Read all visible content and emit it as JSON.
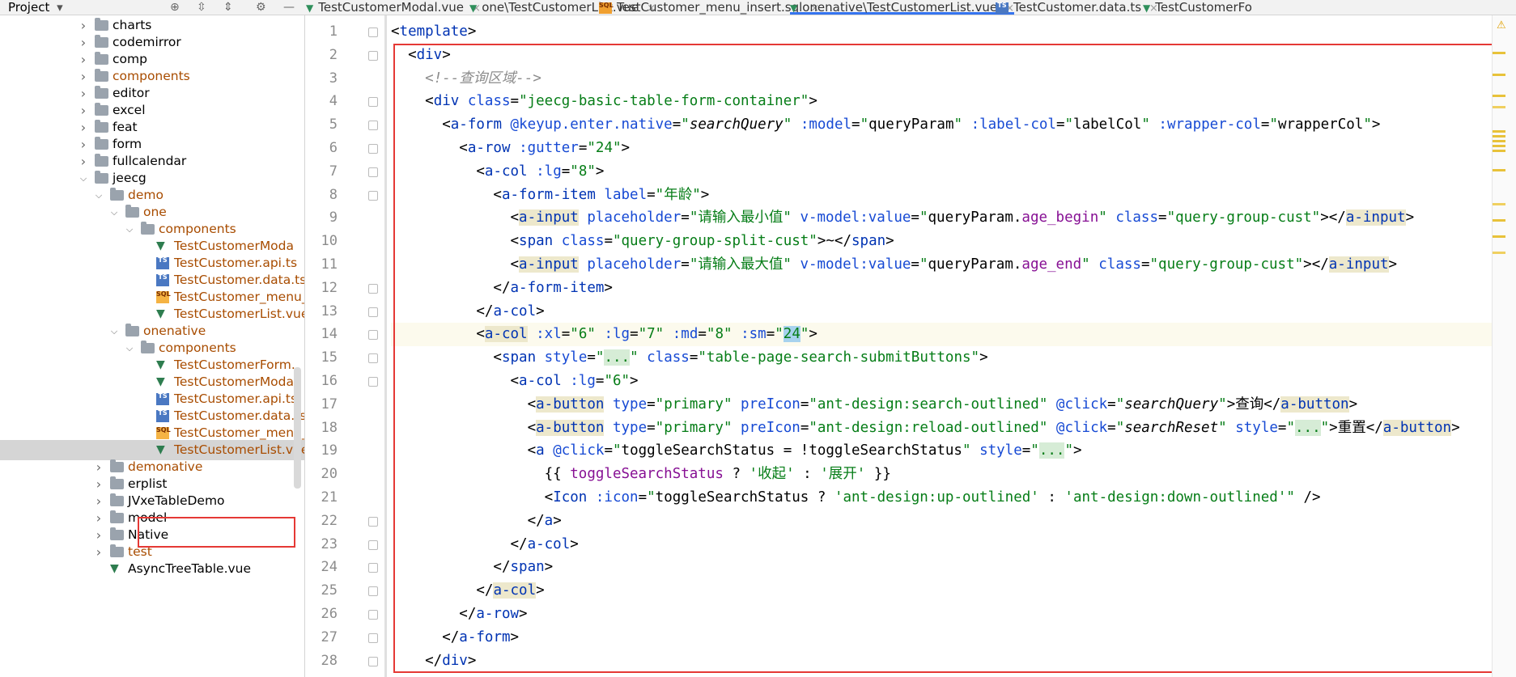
{
  "project_header": {
    "title": "Project",
    "dropdown_icon": "caret-down-icon"
  },
  "toolbar_icons": [
    "target-icon",
    "expand-all-icon",
    "collapse-all-icon",
    "gear-icon",
    "minimize-icon"
  ],
  "tabs": [
    {
      "label": "TestCustomerModal.vue",
      "icon": "vue-icon",
      "active": false
    },
    {
      "label": "one\\TestCustomerList.vue",
      "icon": "vue-icon",
      "active": false
    },
    {
      "label": "TestCustomer_menu_insert.sql",
      "icon": "sql-icon",
      "active": false
    },
    {
      "label": "onenative\\TestCustomerList.vue",
      "icon": "vue-icon",
      "active": true
    },
    {
      "label": "TestCustomer.data.ts",
      "icon": "ts-icon",
      "active": false
    },
    {
      "label": "TestCustomerFo",
      "icon": "vue-icon",
      "active": false
    }
  ],
  "icon_text": {
    "ts": "TS",
    "sql": "SQL",
    "vue": "▼",
    "close": "×",
    "caret": "▾",
    "warn": "⚠"
  },
  "tree": [
    {
      "label": "charts",
      "kind": "folder",
      "expanded": false,
      "color": "#000000"
    },
    {
      "label": "codemirror",
      "kind": "folder",
      "expanded": false,
      "color": "#000000"
    },
    {
      "label": "comp",
      "kind": "folder",
      "expanded": false,
      "color": "#000000"
    },
    {
      "label": "components",
      "kind": "folder",
      "expanded": false,
      "color": "#a84c00"
    },
    {
      "label": "editor",
      "kind": "folder",
      "expanded": false,
      "color": "#000000"
    },
    {
      "label": "excel",
      "kind": "folder",
      "expanded": false,
      "color": "#000000"
    },
    {
      "label": "feat",
      "kind": "folder",
      "expanded": false,
      "color": "#000000"
    },
    {
      "label": "form",
      "kind": "folder",
      "expanded": false,
      "color": "#000000"
    },
    {
      "label": "fullcalendar",
      "kind": "folder",
      "expanded": false,
      "color": "#000000"
    },
    {
      "label": "jeecg",
      "kind": "folder",
      "expanded": true,
      "color": "#000000"
    },
    {
      "label": "demo",
      "kind": "folder",
      "expanded": true,
      "color": "#a84c00"
    },
    {
      "label": "one",
      "kind": "folder",
      "expanded": true,
      "color": "#a84c00"
    },
    {
      "label": "components",
      "kind": "folder",
      "expanded": true,
      "color": "#a84c00"
    },
    {
      "label": "TestCustomerModa",
      "kind": "vue",
      "color": "#a84c00"
    },
    {
      "label": "TestCustomer.api.ts",
      "kind": "ts",
      "color": "#a84c00"
    },
    {
      "label": "TestCustomer.data.ts",
      "kind": "ts",
      "color": "#a84c00"
    },
    {
      "label": "TestCustomer_menu_in",
      "kind": "sql",
      "color": "#a84c00"
    },
    {
      "label": "TestCustomerList.vue",
      "kind": "vue",
      "color": "#a84c00"
    },
    {
      "label": "onenative",
      "kind": "folder",
      "expanded": true,
      "color": "#a84c00"
    },
    {
      "label": "components",
      "kind": "folder",
      "expanded": true,
      "color": "#a84c00"
    },
    {
      "label": "TestCustomerForm.",
      "kind": "vue",
      "color": "#a84c00"
    },
    {
      "label": "TestCustomerModa",
      "kind": "vue",
      "color": "#a84c00"
    },
    {
      "label": "TestCustomer.api.ts",
      "kind": "ts",
      "color": "#a84c00"
    },
    {
      "label": "TestCustomer.data.ts",
      "kind": "ts",
      "color": "#a84c00"
    },
    {
      "label": "TestCustomer_menu_in",
      "kind": "sql",
      "color": "#a84c00"
    },
    {
      "label": "TestCustomerList.vue",
      "kind": "vue",
      "color": "#a84c00",
      "selected": true
    },
    {
      "label": "demonative",
      "kind": "folder",
      "expanded": false,
      "color": "#a84c00"
    },
    {
      "label": "erplist",
      "kind": "folder",
      "expanded": false,
      "color": "#000000"
    },
    {
      "label": "JVxeTableDemo",
      "kind": "folder",
      "expanded": false,
      "color": "#000000"
    },
    {
      "label": "model",
      "kind": "folder",
      "expanded": false,
      "color": "#000000"
    },
    {
      "label": "Native",
      "kind": "folder",
      "expanded": false,
      "color": "#000000"
    },
    {
      "label": "test",
      "kind": "folder",
      "expanded": false,
      "color": "#a84c00"
    },
    {
      "label": "AsyncTreeTable.vue",
      "kind": "vue",
      "color": "#000000"
    }
  ],
  "editor": {
    "current_line": 14,
    "line_numbers": [
      "1",
      "2",
      "3",
      "4",
      "5",
      "6",
      "7",
      "8",
      "9",
      "10",
      "11",
      "12",
      "13",
      "14",
      "15",
      "16",
      "17",
      "18",
      "19",
      "20",
      "21",
      "22",
      "23",
      "24",
      "25",
      "26",
      "27",
      "28"
    ],
    "lines": [
      [
        "<",
        "template",
        ">"
      ],
      [
        "  <",
        "div",
        ">"
      ],
      [
        "    ",
        "<!--查询区域-->"
      ],
      [
        "    <",
        "div",
        " ",
        "class",
        "=",
        "\"jeecg-basic-table-form-container\"",
        ">"
      ],
      [
        "      <",
        "a-form",
        " ",
        "@keyup.enter.native",
        "=",
        "\"",
        "searchQuery",
        "\"",
        " ",
        ":model",
        "=",
        "\"",
        "queryParam",
        "\"",
        " ",
        ":label-col",
        "=",
        "\"",
        "labelCol",
        "\"",
        " ",
        ":wrapper-col",
        "=",
        "\"",
        "wrapperCol",
        "\"",
        ">"
      ],
      [
        "        <",
        "a-row",
        " ",
        ":gutter",
        "=",
        "\"24\"",
        ">"
      ],
      [
        "          <",
        "a-col",
        " ",
        ":lg",
        "=",
        "\"8\"",
        ">"
      ],
      [
        "            <",
        "a-form-item",
        " ",
        "label",
        "=",
        "\"年龄\"",
        ">"
      ],
      [
        "              <",
        "a-input",
        " ",
        "placeholder",
        "=",
        "\"请输入最小值\"",
        " ",
        "v-model:value",
        "=",
        "\"",
        "queryParam",
        ".",
        "age_begin",
        "\"",
        " ",
        "class",
        "=",
        "\"query-group-cust\"",
        "></",
        "a-input",
        ">"
      ],
      [
        "              <",
        "span",
        " ",
        "class",
        "=",
        "\"query-group-split-cust\"",
        ">~</",
        "span",
        ">"
      ],
      [
        "              <",
        "a-input",
        " ",
        "placeholder",
        "=",
        "\"请输入最大值\"",
        " ",
        "v-model:value",
        "=",
        "\"",
        "queryParam",
        ".",
        "age_end",
        "\"",
        " ",
        "class",
        "=",
        "\"query-group-cust\"",
        "></",
        "a-input",
        ">"
      ],
      [
        "            </",
        "a-form-item",
        ">"
      ],
      [
        "          </",
        "a-col",
        ">"
      ],
      [
        "          <",
        "a-col",
        " ",
        ":xl",
        "=",
        "\"6\"",
        " ",
        ":lg",
        "=",
        "\"7\"",
        " ",
        ":md",
        "=",
        "\"8\"",
        " ",
        ":sm",
        "=",
        "\"",
        "24",
        "\"",
        ">"
      ],
      [
        "            <",
        "span",
        " ",
        "style",
        "=",
        "\"",
        "...",
        "\"",
        " ",
        "class",
        "=",
        "\"table-page-search-submitButtons\"",
        ">"
      ],
      [
        "              <",
        "a-col",
        " ",
        ":lg",
        "=",
        "\"6\"",
        ">"
      ],
      [
        "                <",
        "a-button",
        " ",
        "type",
        "=",
        "\"primary\"",
        " ",
        "preIcon",
        "=",
        "\"ant-design:search-outlined\"",
        " ",
        "@click",
        "=",
        "\"",
        "searchQuery",
        "\"",
        ">查询</",
        "a-button",
        ">"
      ],
      [
        "                <",
        "a-button",
        " ",
        "type",
        "=",
        "\"primary\"",
        " ",
        "preIcon",
        "=",
        "\"ant-design:reload-outlined\"",
        " ",
        "@click",
        "=",
        "\"",
        "searchReset",
        "\"",
        " ",
        "style",
        "=",
        "\"",
        "...",
        "\"",
        ">重置</",
        "a-button",
        ">"
      ],
      [
        "                <",
        "a",
        " ",
        "@click",
        "=",
        "\"",
        "toggleSearchStatus = !toggleSearchStatus",
        "\"",
        " ",
        "style",
        "=",
        "\"",
        "...",
        "\"",
        ">"
      ],
      [
        "                  {{ ",
        "toggleSearchStatus",
        " ? ",
        "'收起'",
        " : ",
        "'展开'",
        " }}"
      ],
      [
        "                  <",
        "Icon",
        " ",
        ":icon",
        "=",
        "\"",
        "toggleSearchStatus ? ",
        "'ant-design:up-outlined'",
        " : ",
        "'ant-design:down-outlined'",
        "\"",
        " />"
      ],
      [
        "                </",
        "a",
        ">"
      ],
      [
        "              </",
        "a-col",
        ">"
      ],
      [
        "            </",
        "span",
        ">"
      ],
      [
        "          </",
        "a-col",
        ">"
      ],
      [
        "        </",
        "a-row",
        ">"
      ],
      [
        "      </",
        "a-form",
        ">"
      ],
      [
        "    </",
        "div",
        ">"
      ]
    ]
  }
}
